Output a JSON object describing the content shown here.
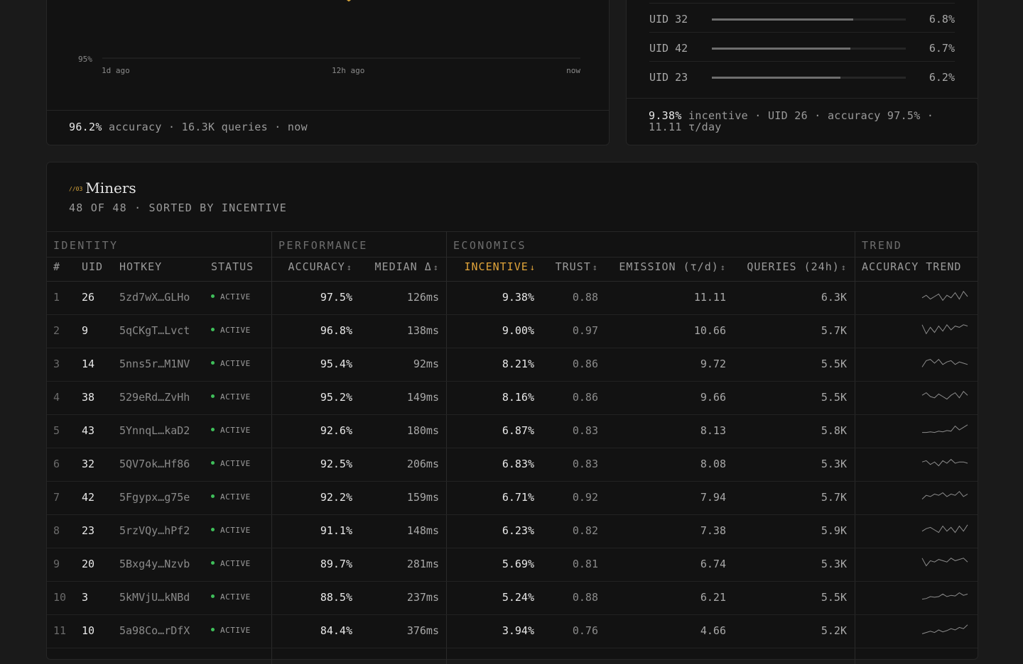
{
  "accuracy_chart": {
    "y_tick": "95%",
    "x_ticks": [
      "1d ago",
      "12h ago",
      "now"
    ],
    "footer": {
      "value": "96.2%",
      "rest": "accuracy · 16.3K queries · now"
    },
    "colors": {
      "line": "#d6a43a"
    }
  },
  "distribution": {
    "rows": [
      {
        "uid": "UID 32",
        "value": "6.8%",
        "fraction": 0.728
      },
      {
        "uid": "UID 42",
        "value": "6.7%",
        "fraction": 0.714
      },
      {
        "uid": "UID 23",
        "value": "6.2%",
        "fraction": 0.663
      }
    ],
    "footer": {
      "value": "9.38%",
      "rest": "incentive · UID 26 · accuracy 97.5% · 11.11 τ/day"
    }
  },
  "miners": {
    "tag": "//03",
    "title": "Miners",
    "subtitle": "48 OF 48 · SORTED BY INCENTIVE",
    "groups": [
      "IDENTITY",
      "PERFORMANCE",
      "ECONOMICS",
      "TREND"
    ],
    "columns": {
      "rank": "#",
      "uid": "UID",
      "hotkey": "HOTKEY",
      "status": "STATUS",
      "accuracy": "ACCURACY",
      "median": "MEDIAN Δ",
      "incentive": "INCENTIVE",
      "trust": "TRUST",
      "emission": "EMISSION (τ/d)",
      "queries": "QUERIES (24h)",
      "trend": "ACCURACY TREND"
    },
    "sort_icon": "↕",
    "sort_active_icon": "↓",
    "colors": {
      "accent": "#e0a43a",
      "active_dot": "#3fbf5a"
    },
    "rows": [
      {
        "rank": "1",
        "uid": "26",
        "hotkey": "5zd7wX…GLHo",
        "status": "ACTIVE",
        "accuracy": "97.5%",
        "median": "126ms",
        "incentive": "9.38%",
        "trust": "0.88",
        "emission": "11.11",
        "queries": "6.3K",
        "trend": [
          0.4,
          0.6,
          0.3,
          0.5,
          0.7,
          0.2,
          0.6,
          0.4,
          0.8,
          0.3,
          0.9,
          0.5
        ]
      },
      {
        "rank": "2",
        "uid": "9",
        "hotkey": "5qCKgT…Lvct",
        "status": "ACTIVE",
        "accuracy": "96.8%",
        "median": "138ms",
        "incentive": "9.00%",
        "trust": "0.97",
        "emission": "10.66",
        "queries": "5.7K",
        "trend": [
          0.9,
          0.2,
          0.7,
          0.3,
          0.8,
          0.4,
          0.9,
          0.5,
          0.8,
          0.7,
          0.9,
          0.8
        ]
      },
      {
        "rank": "3",
        "uid": "14",
        "hotkey": "5nns5r…M1NV",
        "status": "ACTIVE",
        "accuracy": "95.4%",
        "median": "92ms",
        "incentive": "8.21%",
        "trust": "0.86",
        "emission": "9.72",
        "queries": "5.5K",
        "trend": [
          0.2,
          0.7,
          0.8,
          0.5,
          0.8,
          0.4,
          0.6,
          0.7,
          0.4,
          0.6,
          0.5,
          0.4
        ]
      },
      {
        "rank": "4",
        "uid": "38",
        "hotkey": "529eRd…ZvHh",
        "status": "ACTIVE",
        "accuracy": "95.2%",
        "median": "149ms",
        "incentive": "8.16%",
        "trust": "0.86",
        "emission": "9.66",
        "queries": "5.5K",
        "trend": [
          0.6,
          0.8,
          0.5,
          0.4,
          0.7,
          0.5,
          0.3,
          0.6,
          0.8,
          0.4,
          0.9,
          0.6
        ]
      },
      {
        "rank": "5",
        "uid": "43",
        "hotkey": "5YnnqL…kaD2",
        "status": "ACTIVE",
        "accuracy": "92.6%",
        "median": "180ms",
        "incentive": "6.87%",
        "trust": "0.83",
        "emission": "8.13",
        "queries": "5.8K",
        "trend": [
          0.3,
          0.3,
          0.35,
          0.3,
          0.4,
          0.35,
          0.45,
          0.4,
          0.8,
          0.5,
          0.7,
          0.9
        ]
      },
      {
        "rank": "6",
        "uid": "32",
        "hotkey": "5QV7ok…Hf86",
        "status": "ACTIVE",
        "accuracy": "92.5%",
        "median": "206ms",
        "incentive": "6.83%",
        "trust": "0.83",
        "emission": "8.08",
        "queries": "5.3K",
        "trend": [
          0.6,
          0.7,
          0.4,
          0.6,
          0.3,
          0.7,
          0.5,
          0.8,
          0.5,
          0.6,
          0.6,
          0.5
        ]
      },
      {
        "rank": "7",
        "uid": "42",
        "hotkey": "5Fgypx…g75e",
        "status": "ACTIVE",
        "accuracy": "92.2%",
        "median": "159ms",
        "incentive": "6.71%",
        "trust": "0.92",
        "emission": "7.94",
        "queries": "5.7K",
        "trend": [
          0.3,
          0.6,
          0.5,
          0.7,
          0.6,
          0.8,
          0.5,
          0.7,
          0.6,
          0.9,
          0.5,
          0.7
        ]
      },
      {
        "rank": "8",
        "uid": "23",
        "hotkey": "5rzVQy…hPf2",
        "status": "ACTIVE",
        "accuracy": "91.1%",
        "median": "148ms",
        "incentive": "6.23%",
        "trust": "0.82",
        "emission": "7.38",
        "queries": "5.9K",
        "trend": [
          0.4,
          0.6,
          0.7,
          0.5,
          0.3,
          0.8,
          0.4,
          0.7,
          0.3,
          0.8,
          0.4,
          0.9
        ]
      },
      {
        "rank": "9",
        "uid": "20",
        "hotkey": "5Bxg4y…Nzvb",
        "status": "ACTIVE",
        "accuracy": "89.7%",
        "median": "281ms",
        "incentive": "5.69%",
        "trust": "0.81",
        "emission": "6.74",
        "queries": "5.3K",
        "trend": [
          0.9,
          0.3,
          0.7,
          0.6,
          0.8,
          0.7,
          0.6,
          0.9,
          0.7,
          0.8,
          0.9,
          0.6
        ]
      },
      {
        "rank": "10",
        "uid": "3",
        "hotkey": "5kMVjU…kNBd",
        "status": "ACTIVE",
        "accuracy": "88.5%",
        "median": "237ms",
        "incentive": "5.24%",
        "trust": "0.88",
        "emission": "6.21",
        "queries": "5.5K",
        "trend": [
          0.3,
          0.35,
          0.5,
          0.45,
          0.5,
          0.7,
          0.5,
          0.6,
          0.55,
          0.8,
          0.6,
          0.7
        ]
      },
      {
        "rank": "11",
        "uid": "10",
        "hotkey": "5a98Co…rDfX",
        "status": "ACTIVE",
        "accuracy": "84.4%",
        "median": "376ms",
        "incentive": "3.94%",
        "trust": "0.76",
        "emission": "4.66",
        "queries": "5.2K",
        "trend": [
          0.2,
          0.3,
          0.4,
          0.3,
          0.5,
          0.35,
          0.45,
          0.6,
          0.5,
          0.7,
          0.6,
          0.9
        ]
      }
    ]
  }
}
